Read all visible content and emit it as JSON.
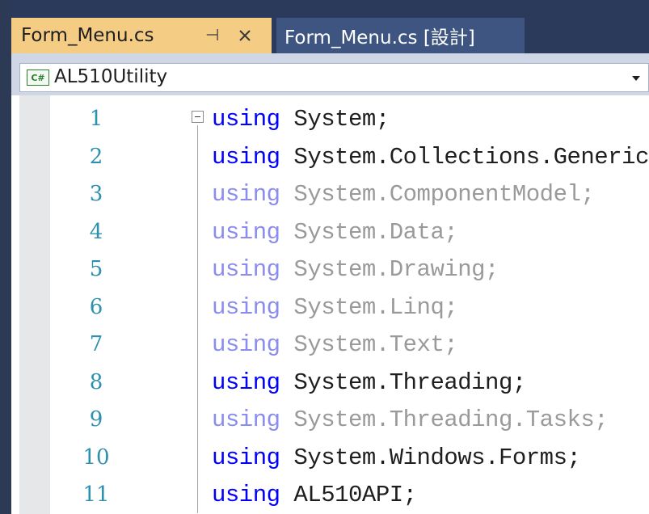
{
  "tabs": [
    {
      "label": "Form_Menu.cs",
      "active": true,
      "pin_icon": "pin-icon",
      "close_icon": "close-icon"
    },
    {
      "label": "Form_Menu.cs [設計]",
      "active": false
    }
  ],
  "navbar": {
    "badge": "C#",
    "project": "AL510Utility",
    "dropdown_icon": "chevron-down-icon"
  },
  "editor": {
    "lines": [
      {
        "num": "1",
        "keyword": "using",
        "namespace": " System;",
        "faded": false
      },
      {
        "num": "2",
        "keyword": "using",
        "namespace": " System.Collections.Generic;",
        "faded": false
      },
      {
        "num": "3",
        "keyword": "using",
        "namespace": " System.ComponentModel;",
        "faded": true
      },
      {
        "num": "4",
        "keyword": "using",
        "namespace": " System.Data;",
        "faded": true
      },
      {
        "num": "5",
        "keyword": "using",
        "namespace": " System.Drawing;",
        "faded": true
      },
      {
        "num": "6",
        "keyword": "using",
        "namespace": " System.Linq;",
        "faded": true
      },
      {
        "num": "7",
        "keyword": "using",
        "namespace": " System.Text;",
        "faded": true
      },
      {
        "num": "8",
        "keyword": "using",
        "namespace": " System.Threading;",
        "faded": false
      },
      {
        "num": "9",
        "keyword": "using",
        "namespace": " System.Threading.Tasks;",
        "faded": true
      },
      {
        "num": "10",
        "keyword": "using",
        "namespace": " System.Windows.Forms;",
        "faded": false
      },
      {
        "num": "11",
        "keyword": "using",
        "namespace": " AL510API;",
        "faded": false
      }
    ]
  },
  "colors": {
    "active_tab": "#f5cc84",
    "inactive_tab": "#3e5582",
    "keyword": "#0000ff",
    "line_number": "#2b91af"
  }
}
